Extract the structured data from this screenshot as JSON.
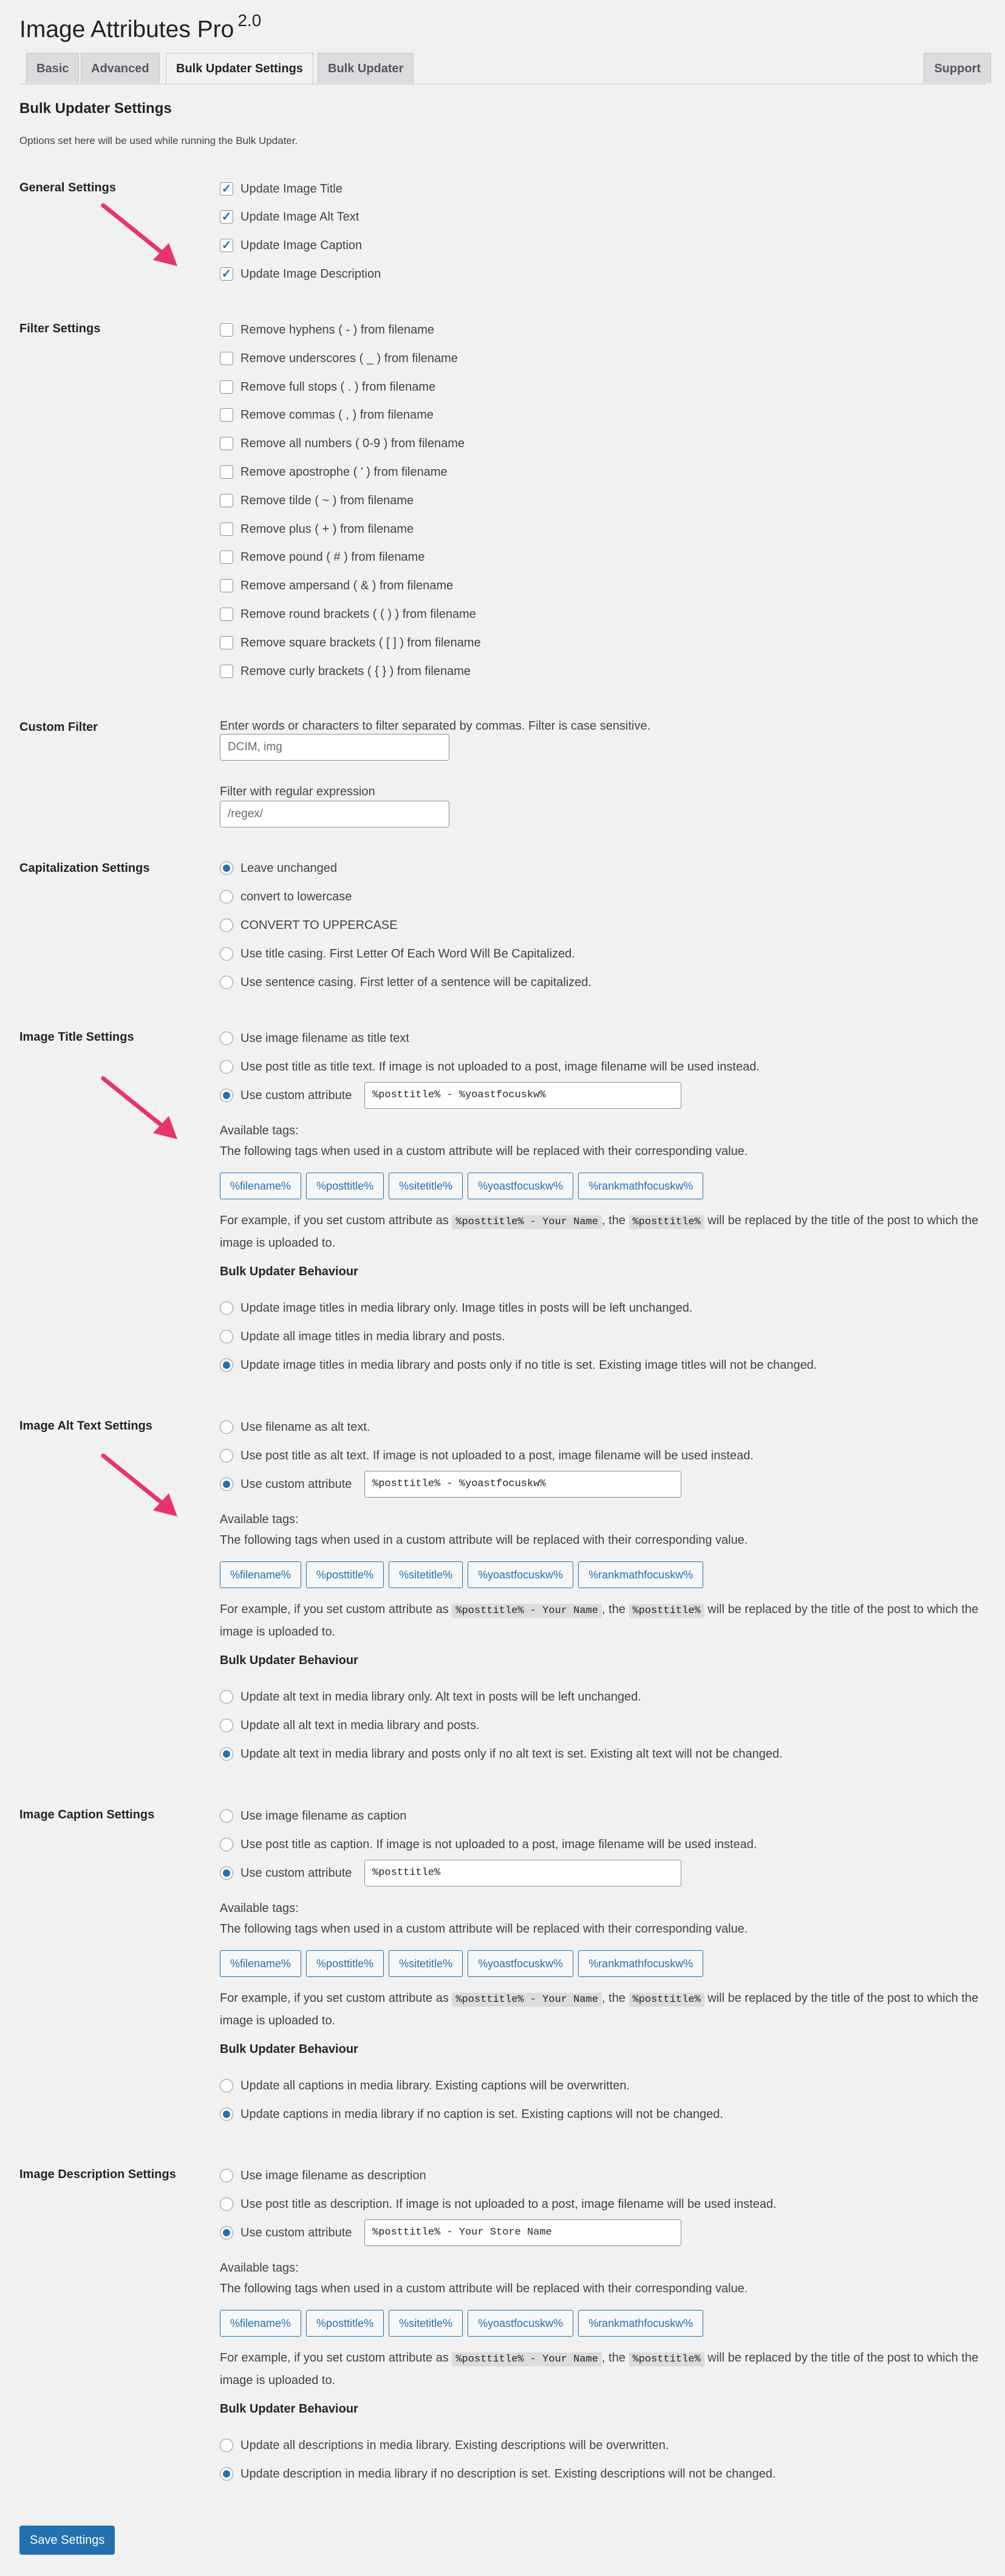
{
  "header": {
    "title": "Image Attributes Pro",
    "version": "2.0"
  },
  "tabs": [
    "Basic",
    "Advanced",
    "Bulk Updater Settings",
    "Bulk Updater",
    "Support"
  ],
  "page": {
    "heading": "Bulk Updater Settings",
    "description": "Options set here will be used while running the Bulk Updater."
  },
  "general": {
    "label": "General Settings",
    "items": [
      "Update Image Title",
      "Update Image Alt Text",
      "Update Image Caption",
      "Update Image Description"
    ]
  },
  "filter": {
    "label": "Filter Settings",
    "items": [
      "Remove hyphens ( - ) from filename",
      "Remove underscores ( _ ) from filename",
      "Remove full stops ( . ) from filename",
      "Remove commas ( , ) from filename",
      "Remove all numbers ( 0-9 ) from filename",
      "Remove apostrophe ( ' ) from filename",
      "Remove tilde ( ~ ) from filename",
      "Remove plus ( + ) from filename",
      "Remove pound ( # ) from filename",
      "Remove ampersand ( & ) from filename",
      "Remove round brackets ( ( ) ) from filename",
      "Remove square brackets ( [ ] ) from filename",
      "Remove curly brackets ( { } ) from filename"
    ]
  },
  "custom_filter": {
    "label": "Custom Filter",
    "description": "Enter words or characters to filter separated by commas. Filter is case sensitive.",
    "input_value": "DCIM, img",
    "regex_label": "Filter with regular expression",
    "regex_value": "/regex/"
  },
  "capitalization": {
    "label": "Capitalization Settings",
    "options": [
      "Leave unchanged",
      "convert to lowercase",
      "CONVERT TO UPPERCASE",
      "Use title casing. First Letter Of Each Word Will Be Capitalized.",
      "Use sentence casing. First letter of a sentence will be capitalized."
    ]
  },
  "common": {
    "use_custom_attribute": "Use custom attribute",
    "available_tags": "Available tags:",
    "tags_desc": "The following tags when used in a custom attribute will be replaced with their corresponding value.",
    "tags": [
      "%filename%",
      "%posttitle%",
      "%sitetitle%",
      "%yoastfocuskw%",
      "%rankmathfocuskw%"
    ],
    "example_prefix": "For example, if you set custom attribute as",
    "example_code1": "%posttitle% - Your Name",
    "example_mid": ", the",
    "example_code2": "%posttitle%",
    "example_suffix": "will be replaced by the title of the post to which the image is uploaded to.",
    "behaviour_heading": "Bulk Updater Behaviour",
    "save_button": "Save Settings"
  },
  "title_settings": {
    "label": "Image Title Settings",
    "opt1": "Use image filename as title text",
    "opt2": "Use post title as title text. If image is not uploaded to a post, image filename will be used instead.",
    "custom_value": "%posttitle% - %yoastfocuskw%",
    "behaviour": [
      "Update image titles in media library only. Image titles in posts will be left unchanged.",
      "Update all image titles in media library and posts.",
      "Update image titles in media library and posts only if no title is set. Existing image titles will not be changed."
    ]
  },
  "alt_settings": {
    "label": "Image Alt Text Settings",
    "opt1": "Use filename as alt text.",
    "opt2": "Use post title as alt text. If image is not uploaded to a post, image filename will be used instead.",
    "custom_value": "%posttitle% - %yoastfocuskw%",
    "behaviour": [
      "Update alt text in media library only. Alt text in posts will be left unchanged.",
      "Update all alt text in media library and posts.",
      "Update alt text in media library and posts only if no alt text is set. Existing alt text will not be changed."
    ]
  },
  "caption_settings": {
    "label": "Image Caption Settings",
    "opt1": "Use image filename as caption",
    "opt2": "Use post title as caption. If image is not uploaded to a post, image filename will be used instead.",
    "custom_value": "%posttitle%",
    "behaviour": [
      "Update all captions in media library. Existing captions will be overwritten.",
      "Update captions in media library if no caption is set. Existing captions will not be changed."
    ]
  },
  "desc_settings": {
    "label": "Image Description Settings",
    "opt1": "Use image filename as description",
    "opt2": "Use post title as description. If image is not uploaded to a post, image filename will be used instead.",
    "custom_value": "%posttitle% - Your Store Name",
    "behaviour": [
      "Update all descriptions in media library. Existing descriptions will be overwritten.",
      "Update description in media library if no description is set. Existing descriptions will not be changed."
    ]
  },
  "colors": {
    "accent": "#2271b1",
    "arrow": "#e8336d",
    "background": "#f1f1f1"
  }
}
